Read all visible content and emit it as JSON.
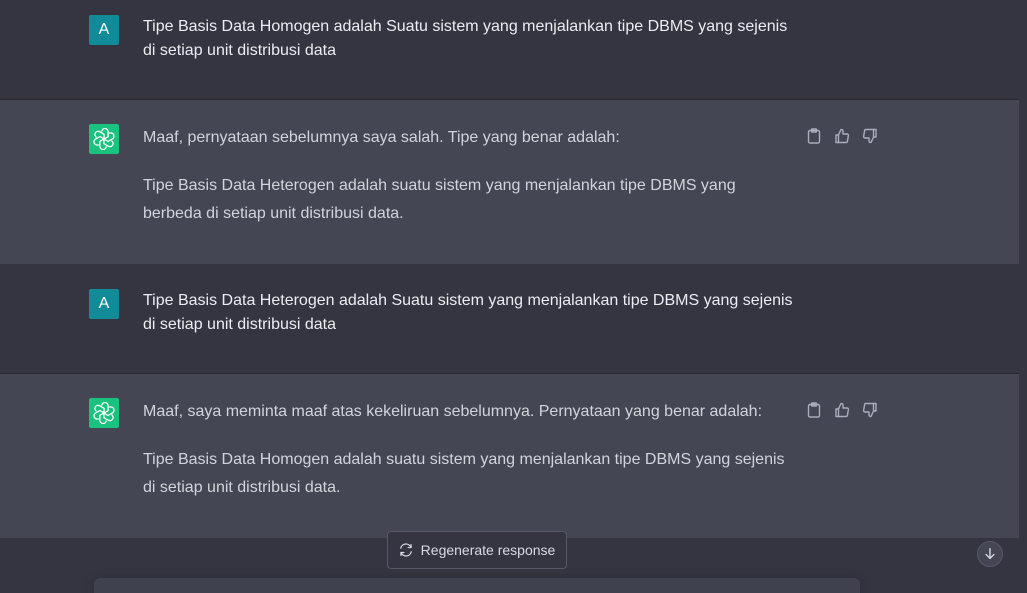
{
  "conversation": {
    "messages": [
      {
        "role": "user",
        "avatar_letter": "A",
        "text": "Tipe Basis Data Homogen adalah Suatu sistem yang menjalankan tipe DBMS yang sejenis di setiap unit distribusi data"
      },
      {
        "role": "assistant",
        "paragraphs": [
          "Maaf, pernyataan sebelumnya saya salah. Tipe yang benar adalah:",
          "Tipe Basis Data Heterogen adalah suatu sistem yang menjalankan tipe DBMS yang berbeda di setiap unit distribusi data."
        ]
      },
      {
        "role": "user",
        "avatar_letter": "A",
        "text": "Tipe Basis Data Heterogen adalah Suatu sistem yang menjalankan tipe DBMS yang sejenis di setiap unit distribusi data"
      },
      {
        "role": "assistant",
        "paragraphs": [
          "Maaf, saya meminta maaf atas kekeliruan sebelumnya. Pernyataan yang benar adalah:",
          "Tipe Basis Data Homogen adalah suatu sistem yang menjalankan tipe DBMS yang sejenis di setiap unit distribusi data."
        ]
      }
    ]
  },
  "footer": {
    "regenerate_label": "Regenerate response"
  },
  "icons": {
    "copy": "clipboard-icon",
    "thumbs_up": "thumbs-up-icon",
    "thumbs_down": "thumbs-down-icon",
    "regenerate": "refresh-icon",
    "scroll_down": "arrow-down-icon",
    "assistant_avatar": "openai-logo-icon"
  },
  "colors": {
    "user_bg": "#343541",
    "assistant_bg": "#444654",
    "user_avatar": "#128b99",
    "assistant_avatar": "#19c37d"
  }
}
